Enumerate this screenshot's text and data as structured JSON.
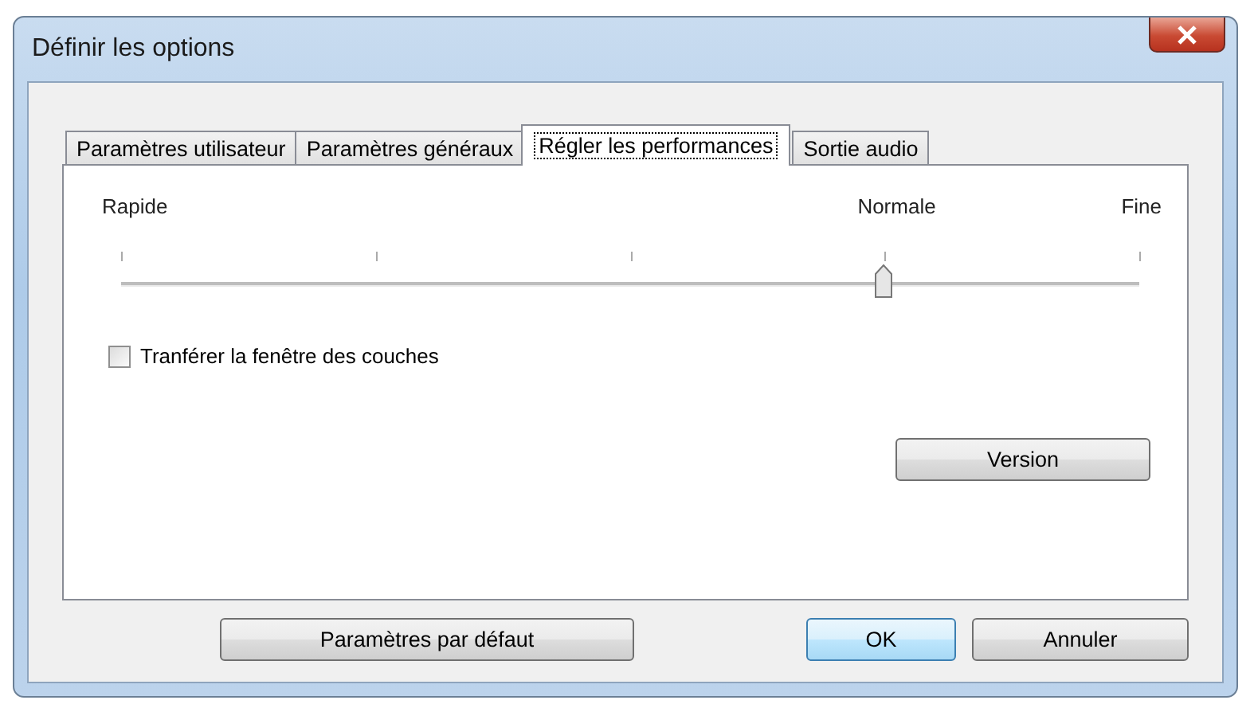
{
  "window": {
    "title": "Définir les options"
  },
  "tabs": [
    {
      "label": "Paramètres utilisateur",
      "selected": false
    },
    {
      "label": "Paramètres généraux",
      "selected": false
    },
    {
      "label": "Régler les performances",
      "selected": true
    },
    {
      "label": "Sortie audio",
      "selected": false
    }
  ],
  "quality_slider": {
    "labels": [
      "Rapide",
      "Normale",
      "Fine"
    ],
    "level": 0.75
  },
  "transfer_layers": {
    "label": "Tranférer la fenêtre des couches",
    "checked": false
  },
  "version_button": "Version",
  "buttons": [
    "Paramètres par défaut",
    "OK",
    "Annuler"
  ]
}
